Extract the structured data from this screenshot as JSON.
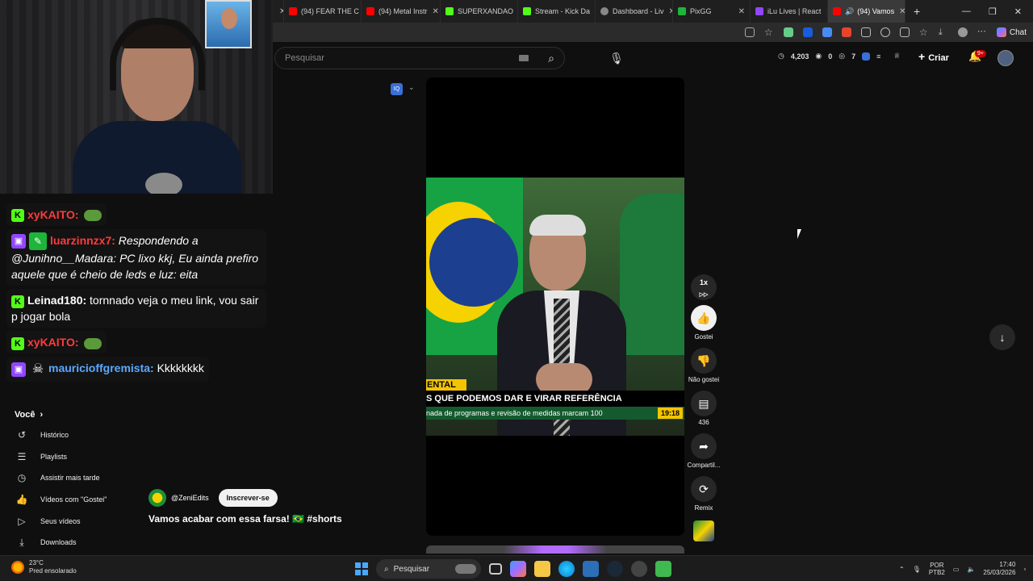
{
  "browser": {
    "tabs": [
      {
        "label": "(94) FEAR THE C",
        "color": "#ff0000"
      },
      {
        "label": "(94) Metal Instr",
        "color": "#ff0000"
      },
      {
        "label": "SUPERXANDAO",
        "color": "#53fc18"
      },
      {
        "label": "Stream - Kick Da",
        "color": "#53fc18"
      },
      {
        "label": "Dashboard - Liv",
        "color": "#888888"
      },
      {
        "label": "PixGG",
        "color": "#1db53a"
      },
      {
        "label": "iLu Lives | React",
        "color": "#9146ff"
      },
      {
        "label": "(94) Vamos",
        "color": "#ff0000"
      }
    ],
    "chat_label": "Chat"
  },
  "header": {
    "search_placeholder": "Pesquisar",
    "stats": [
      "4,203",
      "0",
      "7"
    ],
    "create_label": "Criar",
    "notif_badge": "9+"
  },
  "video": {
    "lower_third_tag": "ENTAL",
    "headline": "S QUE PODEMOS DAR E VIRAR REFERÊNCIA",
    "ticker": "nada de programas e revisão de medidas marcam 100",
    "clock": "19:18"
  },
  "actions": {
    "speed": "1x",
    "like_label": "Gostei",
    "dislike_label": "Não gostei",
    "comments_count": "436",
    "share_label": "Compartil...",
    "remix_label": "Remix"
  },
  "channel": {
    "name": "@ZeniEdits",
    "subscribe_label": "Inscrever-se",
    "title": "Vamos acabar com essa farsa! 🇧🇷 #shorts"
  },
  "chat": [
    {
      "platform": "kick",
      "user": "xyKAITO:",
      "user_color": "#ff3b3b",
      "text": ""
    },
    {
      "platform": "twitch",
      "user": "luarzinnzx7:",
      "user_color": "#ff3b3b",
      "text": "Respondendo a @Junihno__Madara: PC lixo kkj, Eu ainda prefiro aquele que é cheio de leds e luz: eita",
      "italic": true
    },
    {
      "platform": "kick",
      "user": "Leinad180:",
      "user_color": "#ffffff",
      "text": "tornnado veja o meu link, vou sair p jogar bola"
    },
    {
      "platform": "kick",
      "user": "xyKAITO:",
      "user_color": "#ff3b3b",
      "text": ""
    },
    {
      "platform": "twitch",
      "user": "mauricioffgremista:",
      "user_color": "#5aa9ff",
      "text": "Kkkkkkkk"
    }
  ],
  "sidebar": {
    "you_label": "Você",
    "items": [
      {
        "icon": "history-icon",
        "label": "Histórico"
      },
      {
        "icon": "playlists-icon",
        "label": "Playlists"
      },
      {
        "icon": "clock-icon",
        "label": "Assistir mais tarde"
      },
      {
        "icon": "like-icon",
        "label": "Vídeos com \"Gostei\""
      },
      {
        "icon": "your-videos-icon",
        "label": "Seus vídeos"
      },
      {
        "icon": "download-icon",
        "label": "Downloads"
      }
    ]
  },
  "taskbar": {
    "temp": "23°C",
    "weather_text": "Pred ensolarado",
    "search_label": "Pesquisar",
    "lang_line1": "POR",
    "lang_line2": "PTB2",
    "time": "17:40",
    "date": "25/03/2026"
  }
}
